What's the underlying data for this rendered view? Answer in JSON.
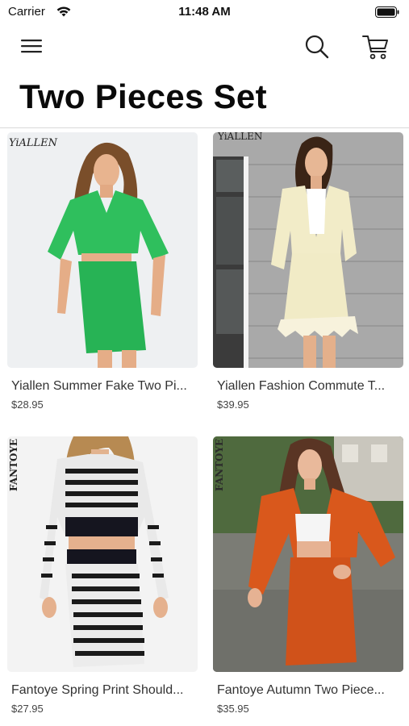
{
  "status_bar": {
    "carrier": "Carrier",
    "time": "11:48 AM"
  },
  "nav": {
    "menu_icon": "hamburger-menu-icon",
    "search_icon": "search-icon",
    "cart_icon": "cart-icon"
  },
  "page": {
    "title": "Two Pieces Set"
  },
  "products": [
    {
      "title": "Yiallen Summer Fake Two Pi...",
      "price": "$28.95",
      "brand_mark": "YiALLEN",
      "outfit_color": "#2fbf5d",
      "background": "#eef0f2"
    },
    {
      "title": "Yiallen Fashion Commute T...",
      "price": "$39.95",
      "brand_mark": "YiALLEN",
      "outfit_color": "#f2ecc8",
      "background": "#a9a9a9"
    },
    {
      "title": "Fantoye Spring Print Should...",
      "price": "$27.95",
      "brand_mark": "FANTOYE",
      "outfit_color": "#1a1a1a",
      "background": "#f3f3f3"
    },
    {
      "title": "Fantoye Autumn Two Piece...",
      "price": "$35.95",
      "brand_mark": "FANTOYE",
      "outfit_color": "#d9581c",
      "background": "#7d7f77"
    }
  ]
}
